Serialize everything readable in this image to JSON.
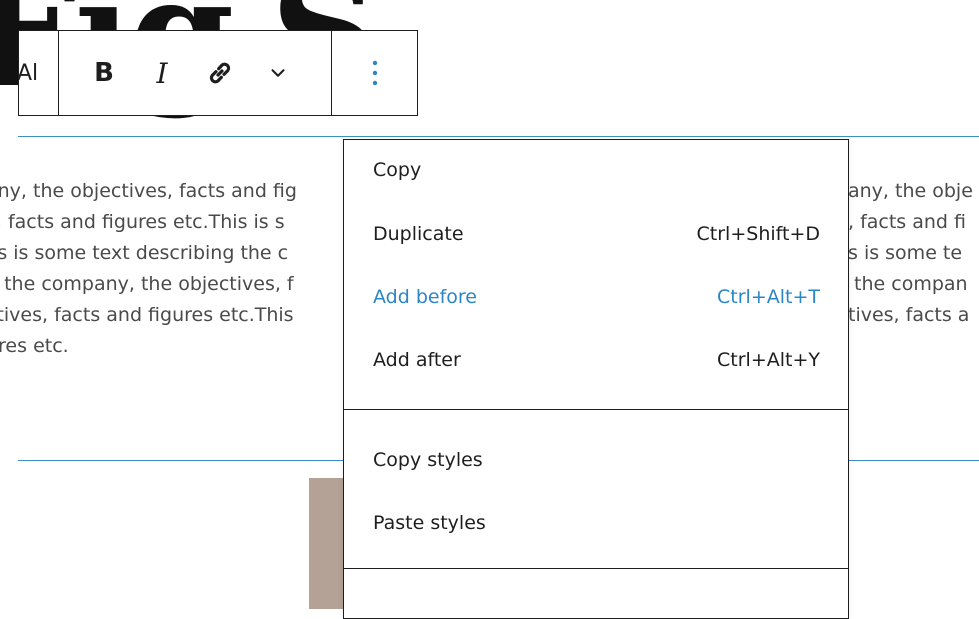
{
  "page": {
    "heading_partial": "Fig",
    "heading_tail": "S",
    "paragraph_left": [
      "any, the objectives, facts and fig",
      "s, facts and figures etc.This is s",
      " is is some text describing the c",
      "g the company, the objectives, f",
      "ctives, facts and figures etc.This",
      "ures etc."
    ],
    "paragraph_right": [
      "any, the obje",
      ", facts and fi",
      "s is some te",
      " the compan",
      "tives, facts a"
    ]
  },
  "toolbar": {
    "block_type_label": "Al",
    "bold_label": "B",
    "italic_label": "I",
    "icons": {
      "link": "link-icon",
      "more": "chevron-down-icon",
      "options": "vertical-ellipsis-icon"
    }
  },
  "menu": {
    "groups": [
      {
        "items": [
          {
            "label": "Copy",
            "shortcut": ""
          },
          {
            "label": "Duplicate",
            "shortcut": "Ctrl+Shift+D"
          },
          {
            "label": "Add before",
            "shortcut": "Ctrl+Alt+T"
          },
          {
            "label": "Add after",
            "shortcut": "Ctrl+Alt+Y"
          }
        ]
      },
      {
        "items": [
          {
            "label": "Copy styles",
            "shortcut": ""
          },
          {
            "label": "Paste styles",
            "shortcut": ""
          }
        ]
      }
    ]
  },
  "colors": {
    "accent": "#2b86c6",
    "rule": "#3d8fc4",
    "image_block": "#b3a295"
  }
}
